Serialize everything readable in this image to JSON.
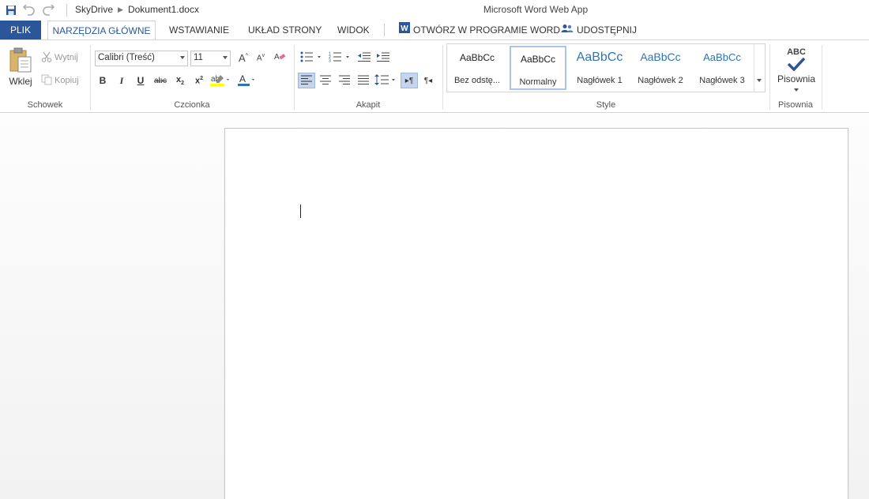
{
  "titlebar": {
    "icons": [
      "save-icon",
      "undo-icon",
      "redo-icon"
    ],
    "breadcrumb_root": "SkyDrive",
    "breadcrumb_doc": "Dokument1.docx",
    "app_title": "Microsoft Word Web App"
  },
  "tabs": {
    "file": "PLIK",
    "home": "NARZĘDZIA GŁÓWNE",
    "insert": "WSTAWIANIE",
    "layout": "UKŁAD STRONY",
    "view": "WIDOK",
    "open_in_word": "OTWÓRZ W PROGRAMIE WORD",
    "share": "UDOSTĘPNIJ"
  },
  "clipboard": {
    "paste": "Wklej",
    "cut": "Wytnij",
    "copy": "Kopiuj",
    "label": "Schowek"
  },
  "font": {
    "font_name": "Calibri (Treść)",
    "font_size": "11",
    "label": "Czcionka",
    "colors": {
      "highlight": "#ffff00",
      "font_color": "#c00000"
    }
  },
  "paragraph": {
    "label": "Akapit"
  },
  "styles": {
    "label": "Style",
    "items": [
      {
        "sample": "AaBbCc",
        "name": "Bez odstę..."
      },
      {
        "sample": "AaBbCc",
        "name": "Normalny"
      },
      {
        "sample": "AaBbCc",
        "name": "Nagłówek 1"
      },
      {
        "sample": "AaBbCc",
        "name": "Nagłówek 2"
      },
      {
        "sample": "AaBbCc",
        "name": "Nagłówek 3"
      }
    ]
  },
  "proofing": {
    "abc": "ABC",
    "spelling": "Pisownia",
    "label": "Pisownia"
  },
  "colors": {
    "accent": "#2b579a",
    "heading": "#2e74b5"
  }
}
